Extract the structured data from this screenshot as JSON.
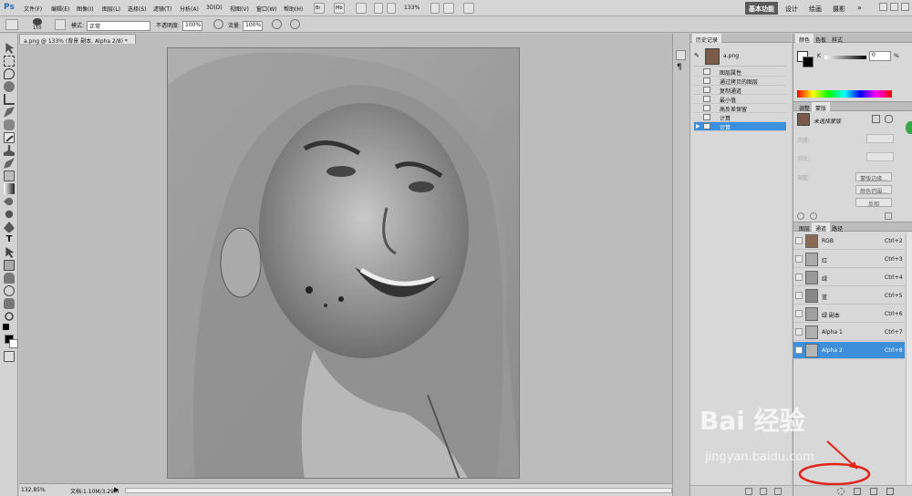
{
  "app": {
    "logo": "Ps"
  },
  "menu": [
    "文件(F)",
    "编辑(E)",
    "图像(I)",
    "图层(L)",
    "选择(S)",
    "滤镜(T)",
    "分析(A)",
    "3D(D)",
    "视图(V)",
    "窗口(W)",
    "帮助(H)"
  ],
  "toolbar": {
    "br_label": "Br",
    "mb_label": "Mb",
    "zoom": "133%"
  },
  "workspaces": {
    "active": "基本功能",
    "items": [
      "设计",
      "绘画",
      "摄影"
    ]
  },
  "options": {
    "brush_size": "150",
    "mode_label": "模式:",
    "mode_value": "正常",
    "opacity_label": "不透明度:",
    "opacity_value": "100%",
    "flow_label": "流量:",
    "flow_value": "100%"
  },
  "document": {
    "tab_title": "a.png @ 133% (背景 副本, Alpha 2/8) *"
  },
  "status": {
    "zoom": "132.85%",
    "doc_info": "文档:1.10M/3.29M"
  },
  "history": {
    "tabs": [
      "历史记录"
    ],
    "snapshot": "a.png",
    "items": [
      "图层属性",
      "通过拷贝的图层",
      "复制通道",
      "最小值",
      "高反差保留",
      "计算",
      "计算"
    ],
    "selected_index": 6
  },
  "color_panel": {
    "tabs": [
      "颜色",
      "色板",
      "样式"
    ],
    "channel_label": "K",
    "value": "0",
    "unit": "%"
  },
  "mask_panel": {
    "tabs": [
      "调整",
      "蒙版"
    ],
    "title": "未选择蒙版",
    "density_label": "浓度:",
    "feather_label": "羽化:",
    "refine_label": "调整:",
    "buttons": [
      "蒙版边缘...",
      "颜色范围...",
      "反相"
    ]
  },
  "channels_panel": {
    "tabs": [
      "图层",
      "通道",
      "路径"
    ],
    "rows": [
      {
        "name": "RGB",
        "shortcut": "Ctrl+2"
      },
      {
        "name": "红",
        "shortcut": "Ctrl+3"
      },
      {
        "name": "绿",
        "shortcut": "Ctrl+4"
      },
      {
        "name": "蓝",
        "shortcut": "Ctrl+5"
      },
      {
        "name": "绿 副本",
        "shortcut": "Ctrl+6"
      },
      {
        "name": "Alpha 1",
        "shortcut": "Ctrl+7"
      },
      {
        "name": "Alpha 2",
        "shortcut": "Ctrl+8"
      }
    ],
    "selected_index": 6
  },
  "watermark": {
    "brand": "Bai  经验",
    "url": "jingyan.baidu.com"
  },
  "colors": {
    "selection": "#3d8fdb",
    "annotation": "#e0241a"
  }
}
